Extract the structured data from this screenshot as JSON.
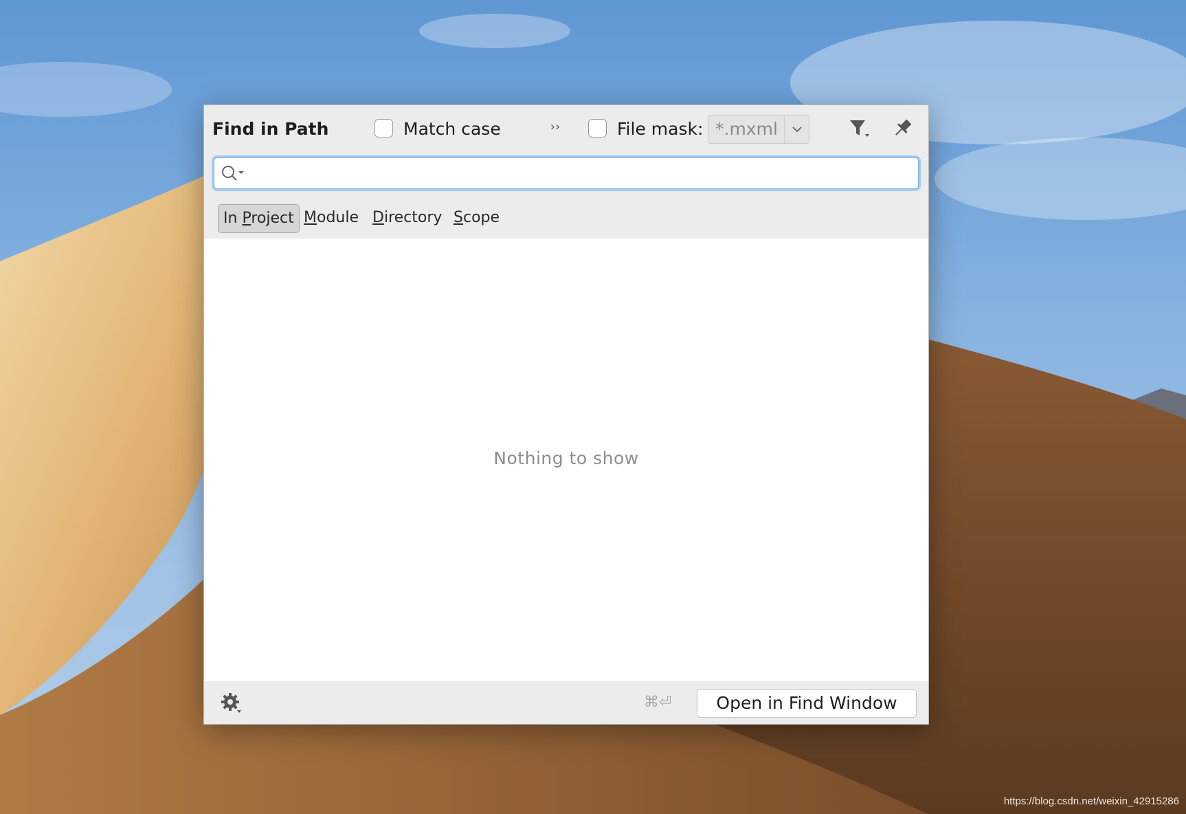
{
  "dialog": {
    "title": "Find in Path",
    "match_case": {
      "label": "Match case",
      "checked": false
    },
    "more_icon": "double-chevron-right-icon",
    "file_mask": {
      "label": "File mask:",
      "value": "*.mxml",
      "checked": false
    },
    "search": {
      "value": "",
      "icon": "search-with-history-icon"
    },
    "scopes": [
      {
        "pre": "In ",
        "u": "P",
        "post": "roject",
        "active": true
      },
      {
        "pre": "",
        "u": "M",
        "post": "odule",
        "active": false
      },
      {
        "pre": "",
        "u": "D",
        "post": "irectory",
        "active": false
      },
      {
        "pre": "",
        "u": "S",
        "post": "cope",
        "active": false
      }
    ],
    "results": {
      "empty_text": "Nothing to show"
    },
    "footer": {
      "shortcut": "⌘⏎",
      "open_button": "Open in Find Window"
    }
  },
  "watermark": "https://blog.csdn.net/weixin_42915286"
}
